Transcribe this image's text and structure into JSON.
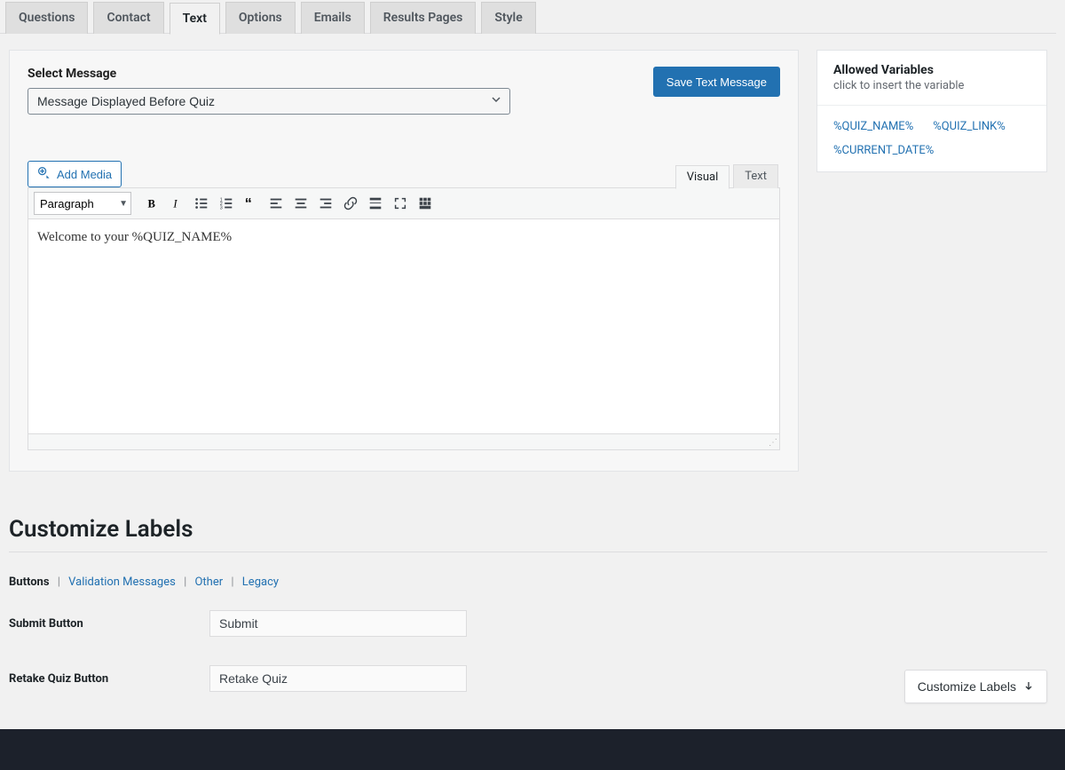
{
  "tabs": [
    {
      "label": "Questions"
    },
    {
      "label": "Contact"
    },
    {
      "label": "Text"
    },
    {
      "label": "Options"
    },
    {
      "label": "Emails"
    },
    {
      "label": "Results Pages"
    },
    {
      "label": "Style"
    }
  ],
  "active_tab_index": 2,
  "select_message": {
    "label": "Select Message",
    "value": "Message Displayed Before Quiz"
  },
  "save_button": "Save Text Message",
  "add_media": "Add Media",
  "editor_tabs": {
    "visual": "Visual",
    "text": "Text",
    "active": "visual"
  },
  "format_select": "Paragraph",
  "editor_content": "Welcome to your %QUIZ_NAME%",
  "sidebar": {
    "title": "Allowed Variables",
    "subtitle": "click to insert the variable",
    "vars": [
      "%QUIZ_NAME%",
      "%QUIZ_LINK%",
      "%CURRENT_DATE%"
    ]
  },
  "labels_section": {
    "heading": "Customize Labels",
    "nav": [
      {
        "label": "Buttons",
        "current": true
      },
      {
        "label": "Validation Messages"
      },
      {
        "label": "Other"
      },
      {
        "label": "Legacy"
      }
    ],
    "fields": [
      {
        "label": "Submit Button",
        "value": "Submit"
      },
      {
        "label": "Retake Quiz Button",
        "value": "Retake Quiz"
      }
    ]
  },
  "fab_label": "Customize Labels"
}
